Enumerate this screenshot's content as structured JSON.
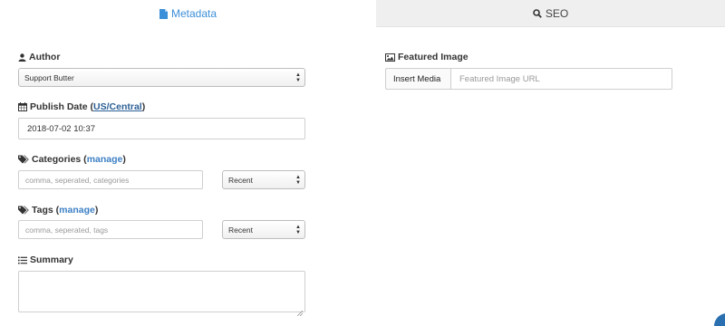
{
  "tabs": [
    {
      "label": "Metadata",
      "icon": "file-icon",
      "active": true
    },
    {
      "label": "SEO",
      "icon": "search-icon",
      "active": false
    }
  ],
  "author": {
    "label": "Author",
    "icon": "user-icon",
    "selected": "Support Butter"
  },
  "publish_date": {
    "label": "Publish Date (",
    "timezone_link": "US/Central",
    "label_close": ")",
    "icon": "calendar-icon",
    "value": "2018-07-02 10:37"
  },
  "categories": {
    "label": "Categories (",
    "manage_link": "manage",
    "label_close": ")",
    "icon": "tags-icon",
    "placeholder": "comma, seperated, categories",
    "sort_selected": "Recent"
  },
  "tags": {
    "label": "Tags (",
    "manage_link": "manage",
    "label_close": ")",
    "icon": "tags-icon",
    "placeholder": "comma, seperated, tags",
    "sort_selected": "Recent"
  },
  "summary": {
    "label": "Summary",
    "icon": "list-icon"
  },
  "featured_image": {
    "label": "Featured Image",
    "icon": "image-icon",
    "insert_button": "Insert Media",
    "url_placeholder": "Featured Image URL"
  },
  "colors": {
    "accent": "#3b8fd9",
    "link": "#3c7fc4",
    "inactive_tab": "#efefef"
  }
}
